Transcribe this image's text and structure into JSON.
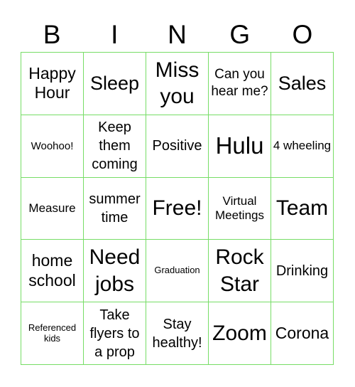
{
  "header": [
    "B",
    "I",
    "N",
    "G",
    "O"
  ],
  "cells": [
    [
      "Happy Hour",
      "Sleep",
      "Miss you",
      "Can you hear me?",
      "Sales"
    ],
    [
      "Woohoo!",
      "Keep them coming",
      "Positive",
      "Hulu",
      "4 wheeling"
    ],
    [
      "Measure",
      "summer time",
      "Free!",
      "Virtual Meetings",
      "Team"
    ],
    [
      "home school",
      "Need jobs",
      "Graduation",
      "Rock Star",
      "Drinking"
    ],
    [
      "Referenced kids",
      "Take flyers to a prop",
      "Stay healthy!",
      "Zoom",
      "Corona"
    ]
  ],
  "colors": {
    "grid_line": "#77dd66",
    "text": "#000000",
    "background": "#ffffff"
  }
}
